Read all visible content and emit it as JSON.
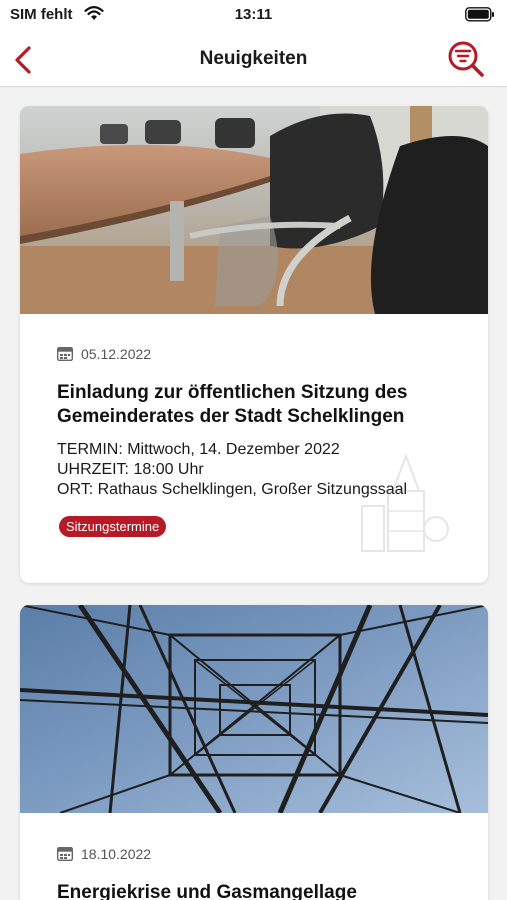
{
  "status_bar": {
    "carrier": "SIM fehlt",
    "time": "13:11"
  },
  "navbar": {
    "title": "Neuigkeiten"
  },
  "news": [
    {
      "date": "05.12.2022",
      "title": "Einladung zur öffentlichen Sitzung des Gemeinderates der Stadt Schelklingen",
      "lines": [
        "TERMIN: Mittwoch, 14. Dezember 2022",
        "UHRZEIT: 18:00 Uhr",
        "ORT: Rathaus Schelklingen, Großer Sitzungssaal"
      ],
      "tag": "Sitzungstermine"
    },
    {
      "date": "18.10.2022",
      "title": "Energiekrise und Gasmangellage"
    }
  ],
  "colors": {
    "accent": "#b51a26",
    "background": "#f2f2f2"
  },
  "icons": [
    "wifi-icon",
    "battery-icon",
    "back-chevron-icon",
    "search-filter-icon",
    "calendar-icon"
  ]
}
